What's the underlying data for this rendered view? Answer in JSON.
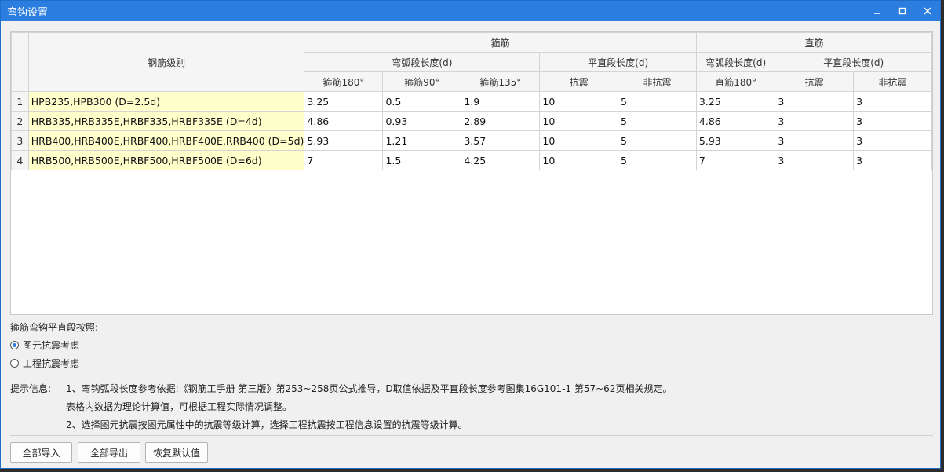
{
  "window": {
    "title": "弯钩设置",
    "minimize_icon": "minimize-icon",
    "maximize_icon": "maximize-icon",
    "close_icon": "close-icon"
  },
  "table": {
    "header": {
      "grade": "钢筋级别",
      "stirrup": "箍筋",
      "straight": "直筋",
      "stirrup_arc": "弯弧段长度(d)",
      "stirrup_flat": "平直段长度(d)",
      "straight_arc": "弯弧段长度(d)",
      "straight_flat": "平直段长度(d)",
      "s180": "箍筋180°",
      "s90": "箍筋90°",
      "s135": "箍筋135°",
      "seismic": "抗震",
      "nonseismic": "非抗震",
      "z180": "直筋180°",
      "z_seismic": "抗震",
      "z_nonseismic": "非抗震"
    },
    "rows": [
      {
        "n": "1",
        "grade": "HPB235,HPB300 (D=2.5d)",
        "s180": "3.25",
        "s90": "0.5",
        "s135": "1.9",
        "seismic": "10",
        "nonseismic": "5",
        "z180": "3.25",
        "z_seismic": "3",
        "z_nonseismic": "3"
      },
      {
        "n": "2",
        "grade": "HRB335,HRB335E,HRBF335,HRBF335E (D=4d)",
        "s180": "4.86",
        "s90": "0.93",
        "s135": "2.89",
        "seismic": "10",
        "nonseismic": "5",
        "z180": "4.86",
        "z_seismic": "3",
        "z_nonseismic": "3"
      },
      {
        "n": "3",
        "grade": "HRB400,HRB400E,HRBF400,HRBF400E,RRB400 (D=5d)",
        "s180": "5.93",
        "s90": "1.21",
        "s135": "3.57",
        "seismic": "10",
        "nonseismic": "5",
        "z180": "5.93",
        "z_seismic": "3",
        "z_nonseismic": "3"
      },
      {
        "n": "4",
        "grade": "HRB500,HRB500E,HRBF500,HRBF500E (D=6d)",
        "s180": "7",
        "s90": "1.5",
        "s135": "4.25",
        "seismic": "10",
        "nonseismic": "5",
        "z180": "7",
        "z_seismic": "3",
        "z_nonseismic": "3"
      }
    ]
  },
  "options": {
    "label": "箍筋弯钩平直段按照:",
    "radio1": "图元抗震考虑",
    "radio2": "工程抗震考虑",
    "selected": "图元抗震考虑"
  },
  "info": {
    "label": "提示信息:",
    "line1": "1、弯钩弧段长度参考依据:《钢筋工手册 第三版》第253~258页公式推导，D取值依据及平直段长度参考图集16G101-1 第57~62页相关规定。",
    "line2": "表格内数据为理论计算值，可根据工程实际情况调整。",
    "line3": "2、选择图元抗震按图元属性中的抗震等级计算，选择工程抗震按工程信息设置的抗震等级计算。"
  },
  "buttons": {
    "import_all": "全部导入",
    "export_all": "全部导出",
    "restore_default": "恢复默认值"
  },
  "colors": {
    "titlebar": "#2b7de0",
    "grade_cell": "#ffffcc",
    "radio_selected": "#2b7de0"
  }
}
